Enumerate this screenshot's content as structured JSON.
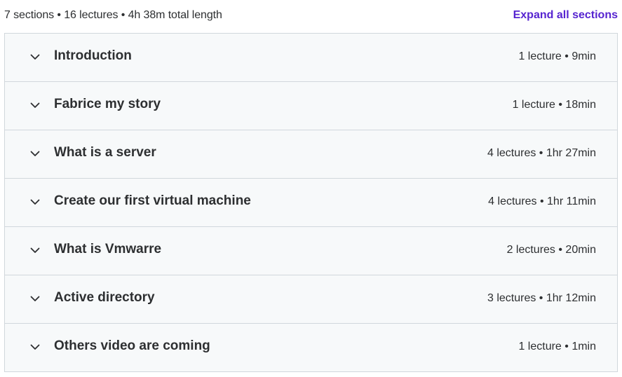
{
  "summary": {
    "text": "7 sections • 16 lectures • 4h 38m total length",
    "expand_label": "Expand all sections"
  },
  "colors": {
    "accent": "#5624d0",
    "text": "#2d2f31",
    "row_bg": "#f7f9fa",
    "border": "#d1d7dc"
  },
  "sections": [
    {
      "title": "Introduction",
      "meta": "1 lecture • 9min",
      "icon": "chevron-down-icon"
    },
    {
      "title": "Fabrice my story",
      "meta": "1 lecture • 18min",
      "icon": "chevron-down-icon"
    },
    {
      "title": "What is a server",
      "meta": "4 lectures • 1hr 27min",
      "icon": "chevron-down-icon"
    },
    {
      "title": "Create our first virtual machine",
      "meta": "4 lectures • 1hr 11min",
      "icon": "chevron-down-icon"
    },
    {
      "title": "What is Vmwarre",
      "meta": "2 lectures • 20min",
      "icon": "chevron-down-icon"
    },
    {
      "title": "Active directory",
      "meta": "3 lectures • 1hr 12min",
      "icon": "chevron-down-icon"
    },
    {
      "title": "Others video are coming",
      "meta": "1 lecture • 1min",
      "icon": "chevron-down-icon"
    }
  ]
}
